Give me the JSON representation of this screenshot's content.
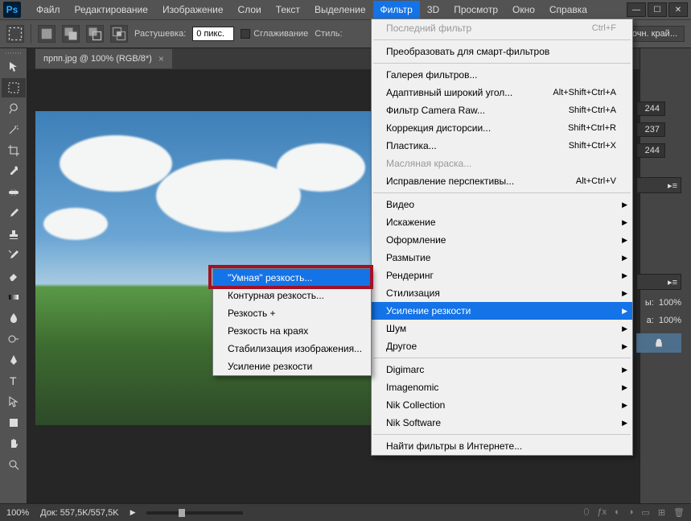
{
  "menubar": [
    "Файл",
    "Редактирование",
    "Изображение",
    "Слои",
    "Текст",
    "Выделение",
    "Фильтр",
    "3D",
    "Просмотр",
    "Окно",
    "Справка"
  ],
  "menubar_open_index": 6,
  "options": {
    "feather_label": "Растушевка:",
    "feather_value": "0 пикс.",
    "antialias_label": "Сглаживание",
    "style_label": "Стиль:",
    "refine_label": "Уточн. край..."
  },
  "tab": {
    "title": "прпп.jpg @ 100% (RGB/8*)",
    "close": "×"
  },
  "right": {
    "values": [
      "244",
      "237",
      "244"
    ],
    "opacity1_label": "ы:",
    "opacity1_value": "100%",
    "opacity2_label": "а:",
    "opacity2_value": "100%"
  },
  "status": {
    "zoom": "100%",
    "doc_label": "Док:",
    "doc_value": "557,5K/557,5K"
  },
  "filter_menu": {
    "last_filter": "Последний фильтр",
    "last_filter_sc": "Ctrl+F",
    "smart_convert": "Преобразовать для смарт-фильтров",
    "gallery": "Галерея фильтров...",
    "adaptive_wide": "Адаптивный широкий угол...",
    "adaptive_wide_sc": "Alt+Shift+Ctrl+A",
    "camera_raw": "Фильтр Camera Raw...",
    "camera_raw_sc": "Shift+Ctrl+A",
    "lens_correction": "Коррекция дисторсии...",
    "lens_correction_sc": "Shift+Ctrl+R",
    "liquify": "Пластика...",
    "liquify_sc": "Shift+Ctrl+X",
    "oil_paint": "Масляная краска...",
    "vanishing": "Исправление перспективы...",
    "vanishing_sc": "Alt+Ctrl+V",
    "groups": [
      "Видео",
      "Искажение",
      "Оформление",
      "Размытие",
      "Рендеринг",
      "Стилизация",
      "Усиление резкости",
      "Шум",
      "Другое"
    ],
    "group_hover_index": 6,
    "plugins": [
      "Digimarc",
      "Imagenomic",
      "Nik Collection",
      "Nik Software"
    ],
    "browse": "Найти фильтры в Интернете..."
  },
  "sharpen_submenu": {
    "items": [
      "\"Умная\" резкость...",
      "Контурная резкость...",
      "Резкость +",
      "Резкость на краях",
      "Стабилизация изображения...",
      "Усиление резкости"
    ],
    "hover_index": 0
  }
}
